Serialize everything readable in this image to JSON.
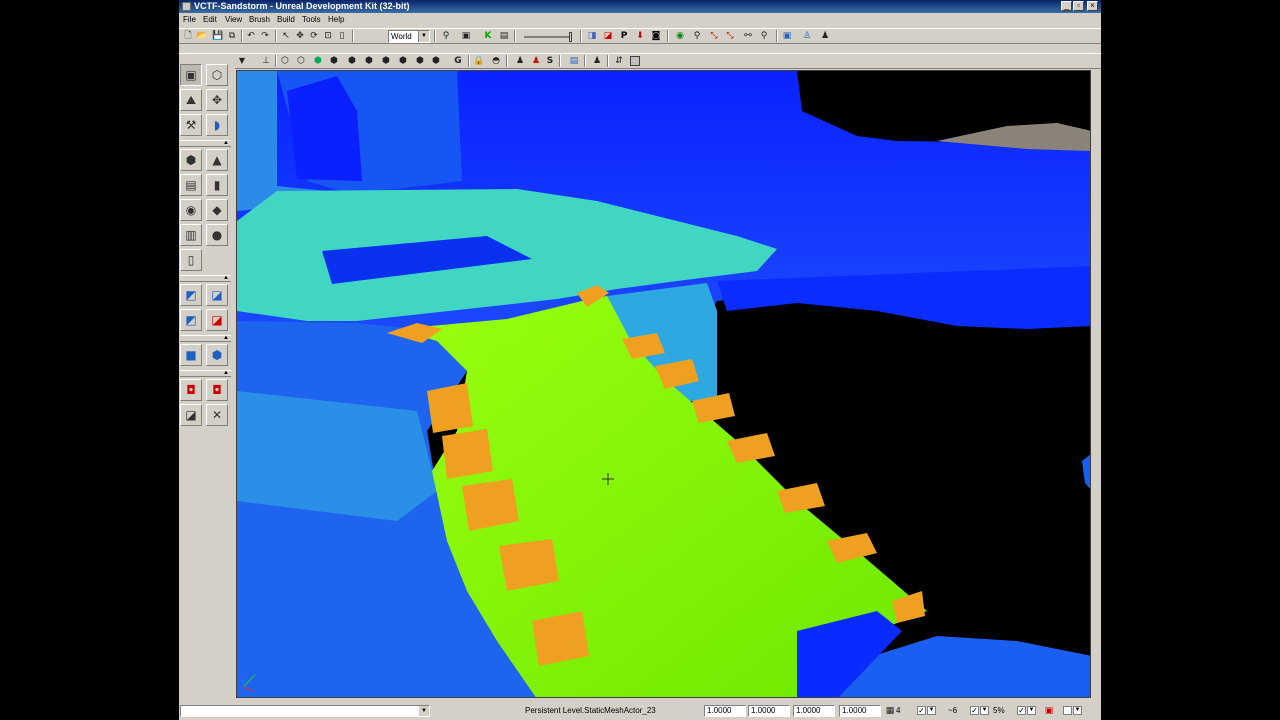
{
  "window": {
    "title": "VCTF-Sandstorm - Unreal Development Kit (32-bit)"
  },
  "menu": [
    "File",
    "Edit",
    "View",
    "Brush",
    "Build",
    "Tools",
    "Help"
  ],
  "toolbar": {
    "coordinate_system": "World"
  },
  "viewport_toolbar": {
    "g_label": "G",
    "s_label": "S"
  },
  "main_toolbar_icons": {
    "p_label": "P",
    "k_label": "K"
  },
  "status": {
    "selection": "Persistent Level.StaticMeshActor_23",
    "drag_grid_values": [
      "1.0000",
      "1.0000",
      "1.0000",
      "1.0000"
    ],
    "grid_size": "4",
    "rotation_snap": "~6",
    "scale_snap": "5%"
  },
  "colors": {
    "title_bar": "#0a246a",
    "window_chrome": "#d4d0c8",
    "lightmap_high": "#7ef000",
    "lightmap_mid": "#40e0a0",
    "lightmap_low": "#0033ff",
    "lightmap_hot": "#f0a020"
  }
}
